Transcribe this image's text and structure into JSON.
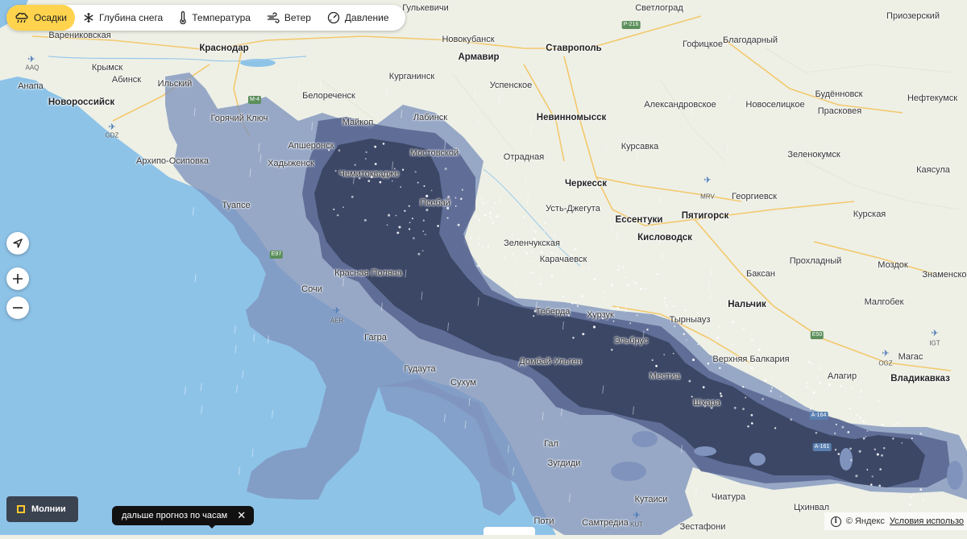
{
  "layers": [
    {
      "label": "Осадки",
      "icon": "cloud-rain-icon",
      "active": true
    },
    {
      "label": "Глубина снега",
      "icon": "snowflake-icon",
      "active": false
    },
    {
      "label": "Температура",
      "icon": "thermometer-icon",
      "active": false
    },
    {
      "label": "Ветер",
      "icon": "wind-icon",
      "active": false
    },
    {
      "label": "Давление",
      "icon": "pressure-gauge-icon",
      "active": false
    }
  ],
  "controls": {
    "locate": "navigate-arrow-icon",
    "zoom_in": "plus-icon",
    "zoom_out": "minus-icon"
  },
  "lightning": {
    "label": "Молнии"
  },
  "hourly_tip": {
    "label": "дальше прогноз по часам",
    "close": "✕"
  },
  "footer": {
    "brand": "© Яндекс",
    "terms": "Условия использо"
  },
  "colors": {
    "sea": "#8ec3e8",
    "land": "#eef0e6",
    "light_precip": "#7f93bd",
    "heavy_precip": "#3c4766",
    "accent": "#ffd34d"
  },
  "places": [
    {
      "name": "Гулькевичи",
      "big": false
    },
    {
      "name": "Светлоград",
      "big": false
    },
    {
      "name": "Приозерский",
      "big": false
    },
    {
      "name": "Варениковская",
      "big": false
    },
    {
      "name": "Новокубанск",
      "big": false
    },
    {
      "name": "Ставрополь",
      "big": true
    },
    {
      "name": "Гофицкое",
      "big": false
    },
    {
      "name": "Благодарный",
      "big": false
    },
    {
      "name": "Краснодар",
      "big": true
    },
    {
      "name": "Армавир",
      "big": true
    },
    {
      "name": "Крымск",
      "big": false
    },
    {
      "name": "Абинск",
      "big": false
    },
    {
      "name": "Ильский",
      "big": false
    },
    {
      "name": "Анапа",
      "big": false
    },
    {
      "name": "Курганинск",
      "big": false
    },
    {
      "name": "Успенское",
      "big": false
    },
    {
      "name": "Белореченск",
      "big": false
    },
    {
      "name": "Новороссийск",
      "big": true
    },
    {
      "name": "Горячий Ключ",
      "big": false
    },
    {
      "name": "Майкоп",
      "big": false
    },
    {
      "name": "Лабинск",
      "big": false
    },
    {
      "name": "Невинномысск",
      "big": true
    },
    {
      "name": "Александровское",
      "big": false
    },
    {
      "name": "Новоселицкое",
      "big": false
    },
    {
      "name": "Будённовск",
      "big": false
    },
    {
      "name": "Нефтекумск",
      "big": false
    },
    {
      "name": "Прасковея",
      "big": false
    },
    {
      "name": "Апшеронск",
      "big": false
    },
    {
      "name": "Мостовской",
      "big": false
    },
    {
      "name": "Курсавка",
      "big": false
    },
    {
      "name": "Хадыженск",
      "big": false
    },
    {
      "name": "Архипо-Осиповка",
      "big": false
    },
    {
      "name": "Отрадная",
      "big": false
    },
    {
      "name": "Зеленокумск",
      "big": false
    },
    {
      "name": "Каясула",
      "big": false
    },
    {
      "name": "Черкесск",
      "big": true
    },
    {
      "name": "Псебай",
      "big": false
    },
    {
      "name": "Туапсе",
      "big": false
    },
    {
      "name": "Георгиевск",
      "big": false
    },
    {
      "name": "Усть-Джегута",
      "big": false
    },
    {
      "name": "Ессентуки",
      "big": true
    },
    {
      "name": "Пятигорск",
      "big": true
    },
    {
      "name": "Курская",
      "big": false
    },
    {
      "name": "Кисловодск",
      "big": true
    },
    {
      "name": "Зеленчукская",
      "big": false
    },
    {
      "name": "Карачаевск",
      "big": false
    },
    {
      "name": "Прохладный",
      "big": false
    },
    {
      "name": "Моздок",
      "big": false
    },
    {
      "name": "Знаменское",
      "big": false
    },
    {
      "name": "Красная Поляна",
      "big": false
    },
    {
      "name": "Сочи",
      "big": false
    },
    {
      "name": "Баксан",
      "big": false
    },
    {
      "name": "Нальчик",
      "big": true
    },
    {
      "name": "Малгобек",
      "big": false
    },
    {
      "name": "Теберда",
      "big": false
    },
    {
      "name": "Хурзук",
      "big": false
    },
    {
      "name": "Тырныауз",
      "big": false
    },
    {
      "name": "Гагра",
      "big": false
    },
    {
      "name": "Верхняя Балкария",
      "big": false
    },
    {
      "name": "Магас",
      "big": false
    },
    {
      "name": "Гудаута",
      "big": false
    },
    {
      "name": "Местиа",
      "big": false
    },
    {
      "name": "Алагир",
      "big": false
    },
    {
      "name": "Владикавказ",
      "big": true
    },
    {
      "name": "Сухум",
      "big": false
    },
    {
      "name": "Гал",
      "big": false
    },
    {
      "name": "Зугдиди",
      "big": false
    },
    {
      "name": "Кутаиси",
      "big": false
    },
    {
      "name": "Чиатура",
      "big": false
    },
    {
      "name": "Цхинвал",
      "big": false
    },
    {
      "name": "Поти",
      "big": false
    },
    {
      "name": "Самтредиа",
      "big": false
    },
    {
      "name": "Зестафони",
      "big": false
    },
    {
      "name": "Эльбрус",
      "big": false
    },
    {
      "name": "Шхара",
      "big": false
    },
    {
      "name": "Домбай-Ульген",
      "big": false
    },
    {
      "name": "Чемитоквадже",
      "big": false
    }
  ],
  "airports": [
    "AAQ",
    "GDZ",
    "AER",
    "MRV",
    "OGZ",
    "IGT",
    "KUT"
  ],
  "roads": [
    "Р-216",
    "М-4",
    "E97",
    "E50",
    "А-164",
    "А-161"
  ]
}
